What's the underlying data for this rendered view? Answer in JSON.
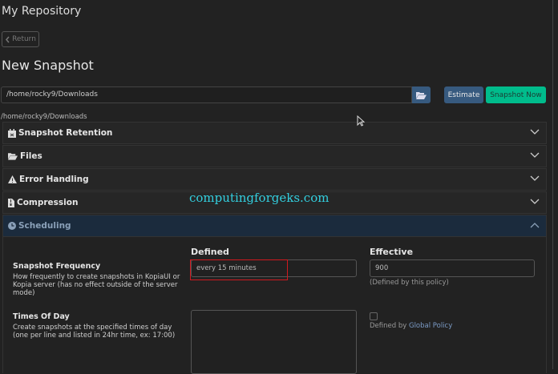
{
  "header": {
    "repo_title": "My Repository",
    "return_label": "Return",
    "page_title": "New Snapshot"
  },
  "source": {
    "path_value": "/home/rocky9/Downloads",
    "path_echo": "/home/rocky9/Downloads",
    "estimate_label": "Estimate",
    "snapshot_now_label": "Snapshot Now"
  },
  "sections": [
    {
      "label": "Snapshot Retention",
      "icon": "calendar-icon"
    },
    {
      "label": "Files",
      "icon": "folder-open-icon"
    },
    {
      "label": "Error Handling",
      "icon": "warning-icon"
    },
    {
      "label": "Compression",
      "icon": "file-zip-icon"
    },
    {
      "label": "Scheduling",
      "icon": "clock-icon",
      "expanded": true
    }
  ],
  "scheduling": {
    "defined_header": "Defined",
    "effective_header": "Effective",
    "frequency": {
      "label": "Snapshot Frequency",
      "description": "How frequently to create snapshots in KopiaUI or Kopia server (has no effect outside of the server mode)",
      "defined_value": "every 15 minutes",
      "effective_value": "900",
      "effective_note": "(Defined by this policy)"
    },
    "times_of_day": {
      "label": "Times Of Day",
      "description": "Create snapshots at the specified times of day (one per line and listed in 24hr time, ex: 17:00)",
      "defined_value": "",
      "effective_checked": false,
      "effective_note_prefix": "Defined by",
      "effective_link": "Global Policy"
    }
  },
  "watermark": "computingforgeks.com",
  "colors": {
    "primary": "#375a7f",
    "success": "#00bc8c",
    "background": "#222222",
    "highlight": "#d0191f"
  }
}
